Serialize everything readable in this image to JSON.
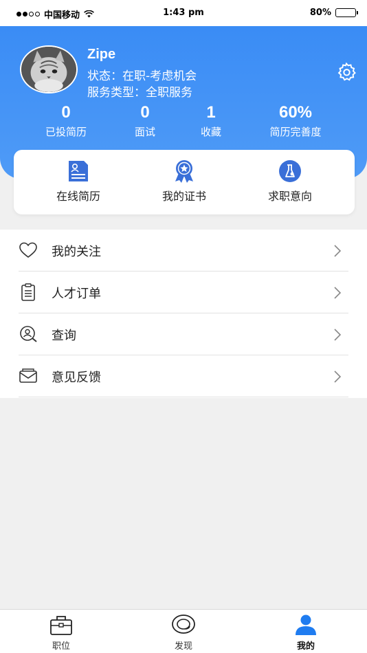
{
  "status_bar": {
    "carrier": "中国移动",
    "time": "1:43 pm",
    "battery": "80%"
  },
  "profile": {
    "name": "Zipe",
    "status": "状态：在职-考虑机会",
    "service_type": "服务类型：全职服务"
  },
  "stats": [
    {
      "value": "0",
      "label": "已投简历"
    },
    {
      "value": "0",
      "label": "面试"
    },
    {
      "value": "1",
      "label": "收藏"
    },
    {
      "value": "60%",
      "label": "简历完善度"
    }
  ],
  "quick_actions": [
    {
      "label": "在线简历",
      "icon": "resume-icon"
    },
    {
      "label": "我的证书",
      "icon": "certificate-icon"
    },
    {
      "label": "求职意向",
      "icon": "intention-icon"
    }
  ],
  "menu": [
    {
      "label": "我的关注",
      "icon": "heart-icon"
    },
    {
      "label": "人才订单",
      "icon": "clipboard-icon"
    },
    {
      "label": "查询",
      "icon": "search-person-icon"
    },
    {
      "label": "意见反馈",
      "icon": "envelope-icon"
    }
  ],
  "tabs": [
    {
      "label": "职位",
      "icon": "briefcase-icon"
    },
    {
      "label": "发现",
      "icon": "chat-bubble-icon"
    },
    {
      "label": "我的",
      "icon": "person-icon",
      "active": true
    }
  ],
  "colors": {
    "header_blue": "#3a8cf5",
    "icon_blue": "#3a6fd8",
    "tab_active": "#1f7cf0"
  }
}
